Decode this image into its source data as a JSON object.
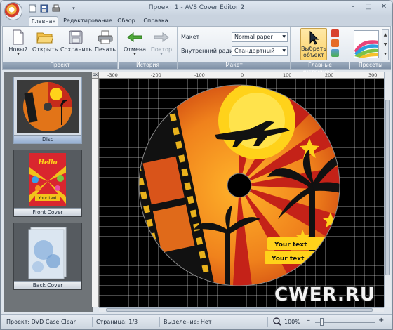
{
  "window": {
    "title": "Проект 1 - AVS Cover Editor 2",
    "controls": {
      "minimize": "–",
      "maximize": "□",
      "close": "✕"
    }
  },
  "quick_access": {
    "icons": [
      "new-icon",
      "save-icon",
      "print-icon"
    ],
    "more_label": "▾"
  },
  "tabs": [
    {
      "label": "Главная",
      "active": true
    },
    {
      "label": "Редактирование",
      "active": false
    },
    {
      "label": "Обзор",
      "active": false
    },
    {
      "label": "Справка",
      "active": false
    }
  ],
  "ribbon": {
    "project": {
      "label": "Проект",
      "new": "Новый",
      "open": "Открыть",
      "save": "Сохранить",
      "print": "Печать"
    },
    "history": {
      "label": "История",
      "undo": "Отмена",
      "redo": "Повтор"
    },
    "layout": {
      "label": "Макет",
      "layout_label": "Макет",
      "layout_value": "Normal paper",
      "radius_label": "Внутренний радиус",
      "radius_value": "Стандартный"
    },
    "tools": {
      "label": "Главные инструменты",
      "select_line1": "Выбрать",
      "select_line2": "объект",
      "small_icons": [
        "text-tool-icon",
        "text-style-icon",
        "image-tool-icon"
      ]
    },
    "presets": {
      "label": "Пресеты"
    }
  },
  "thumbnails": [
    {
      "caption": "Disc",
      "selected": true
    },
    {
      "caption": "Front Cover",
      "selected": false
    },
    {
      "caption": "Back Cover",
      "selected": false
    }
  ],
  "front_cover_art": {
    "title": "Hello",
    "text": "Your text"
  },
  "ruler": {
    "unit": "px",
    "ticks": [
      "-300",
      "-200",
      "-100",
      "0",
      "100",
      "200",
      "300"
    ]
  },
  "disc": {
    "text1": "Your text",
    "text2": "Your text"
  },
  "watermark": "CWER.RU",
  "status": {
    "project": "Проект: DVD Case Clear",
    "page": "Страница: 1/3",
    "selection": "Выделение: Нет",
    "zoom": "100%",
    "zoom_level": 0.1
  },
  "colors": {
    "ribbon_group_label": "#8a9bb0",
    "canvas_bg": "#000000",
    "disc_orange": "#f08a1c",
    "disc_red": "#c42218",
    "disc_yellow": "#ffd21a"
  }
}
